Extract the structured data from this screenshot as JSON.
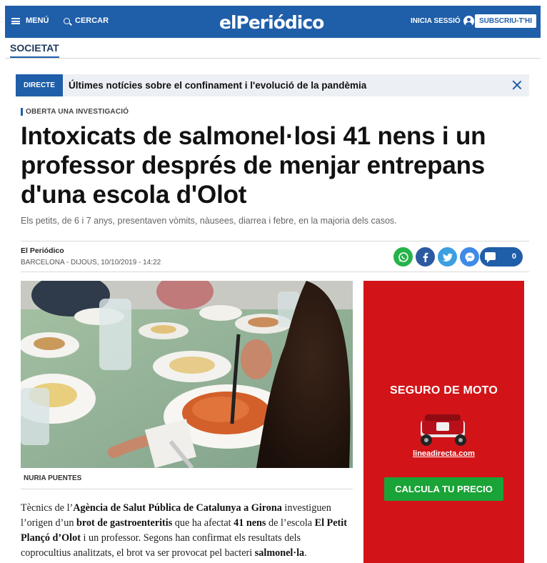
{
  "header": {
    "menu_label": "MENÚ",
    "search_label": "CERCAR",
    "logo": "elPeriódico",
    "login_label": "INICIA SESSIÓ",
    "subscribe_label": "SUBSCRIU-T'HI",
    "brand_color": "#1f5ea8"
  },
  "section": {
    "label": "SOCIETAT"
  },
  "live_banner": {
    "tag": "DIRECTE",
    "text": "Últimes notícies sobre el confinament i l'evolució de la pandèmia"
  },
  "article": {
    "kicker": "OBERTA UNA INVESTIGACIÓ",
    "headline": "Intoxicats de salmonel·losi 41 nens i un professor després de menjar entrepans d'una escola d'Olot",
    "subhead": "Els petits, de 6 i 7 anys, presentaven vòmits, nàusees, diarrea i febre, en la majoria dels casos.",
    "author": "El Periódico",
    "dateline": "BARCELONA - DIJOUS, 10/10/2019 - 14:22",
    "photo_caption": "NURIA PUENTES",
    "body": {
      "p1_a": "Tècnics de l’",
      "p1_b": "Agència de Salut Pública de Catalunya a Girona",
      "p1_c": " investiguen l’origen d’un ",
      "p1_d": "brot de gastroenteritis",
      "p1_e": " que ha afectat ",
      "p1_f": "41 nens",
      "p1_g": " de l’escola ",
      "p1_h": "El Petit Plançó d’Olot",
      "p1_i": " i un professor. Segons han confirmat els resultats dels coprocultius analitzats, el brot va ser provocat pel bacteri ",
      "p1_j": "salmonel·la",
      "p1_k": "."
    }
  },
  "share": {
    "icons": [
      "whatsapp-icon",
      "facebook-icon",
      "twitter-icon",
      "messenger-icon"
    ],
    "comments_count": "0"
  },
  "ad": {
    "title": "SEGURO DE MOTO",
    "url": "lineadirecta.com",
    "cta": "CALCULA TU PRECIO",
    "background": "#d21418",
    "cta_color": "#1aa336"
  }
}
